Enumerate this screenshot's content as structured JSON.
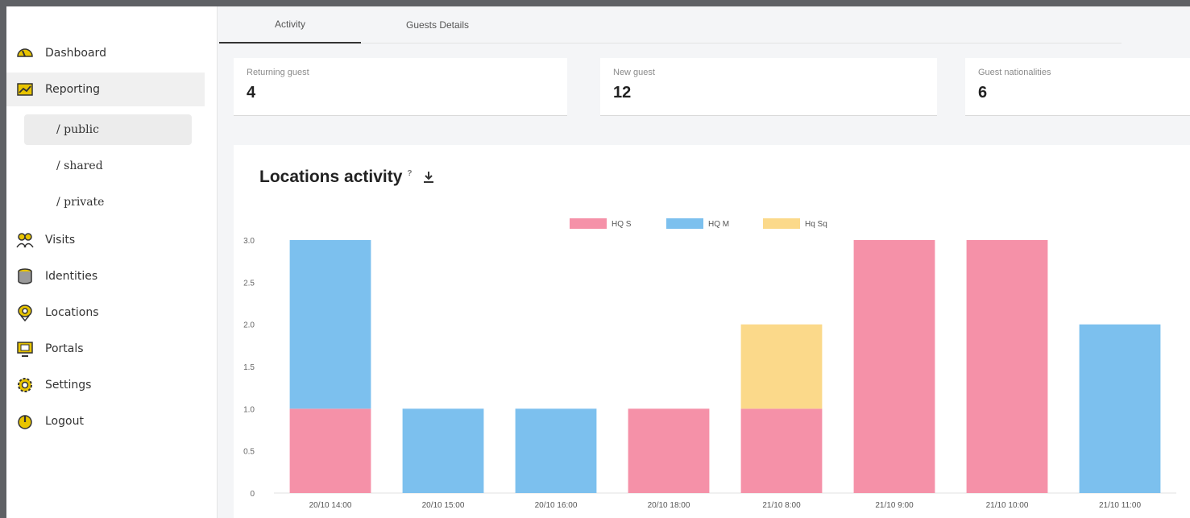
{
  "sidebar": {
    "items": [
      {
        "label": "Dashboard",
        "icon": "speedometer-icon"
      },
      {
        "label": "Reporting",
        "icon": "chart-icon"
      },
      {
        "label": "Visits",
        "icon": "people-icon"
      },
      {
        "label": "Identities",
        "icon": "database-icon"
      },
      {
        "label": "Locations",
        "icon": "location-pin-icon"
      },
      {
        "label": "Portals",
        "icon": "monitor-icon"
      },
      {
        "label": "Settings",
        "icon": "gear-icon"
      },
      {
        "label": "Logout",
        "icon": "power-icon"
      }
    ],
    "sub_items": [
      {
        "label": "/ public"
      },
      {
        "label": "/ shared"
      },
      {
        "label": "/ private"
      }
    ]
  },
  "tabs": [
    {
      "label": "Activity"
    },
    {
      "label": "Guests Details"
    }
  ],
  "stats": [
    {
      "label": "Returning guest",
      "value": "4"
    },
    {
      "label": "New guest",
      "value": "12"
    },
    {
      "label": "Guest nationalities",
      "value": "6"
    }
  ],
  "chart_title": "Locations activity",
  "chart_info": "?",
  "colors": {
    "accent_yellow": "#e8c400",
    "hq_s": "#f591a8",
    "hq_m": "#7cc0ee",
    "hq_sq": "#fbd98a"
  },
  "chart_data": {
    "type": "bar",
    "stacked": true,
    "categories": [
      "20/10 14:00",
      "20/10 15:00",
      "20/10 16:00",
      "20/10 18:00",
      "21/10 8:00",
      "21/10 9:00",
      "21/10 10:00",
      "21/10 11:00"
    ],
    "series": [
      {
        "name": "HQ S",
        "color": "#f591a8",
        "values": [
          1,
          0,
          0,
          1,
          1,
          3,
          3,
          0
        ]
      },
      {
        "name": "HQ M",
        "color": "#7cc0ee",
        "values": [
          2,
          1,
          1,
          0,
          0,
          0,
          0,
          2
        ]
      },
      {
        "name": "Hq Sq",
        "color": "#fbd98a",
        "values": [
          0,
          0,
          0,
          0,
          1,
          0,
          0,
          0
        ]
      }
    ],
    "y_ticks": [
      "0",
      "0.5",
      "1.0",
      "1.5",
      "2.0",
      "2.5",
      "3.0"
    ],
    "ylim": [
      0,
      3
    ],
    "legend": "top-center",
    "grid": false
  }
}
